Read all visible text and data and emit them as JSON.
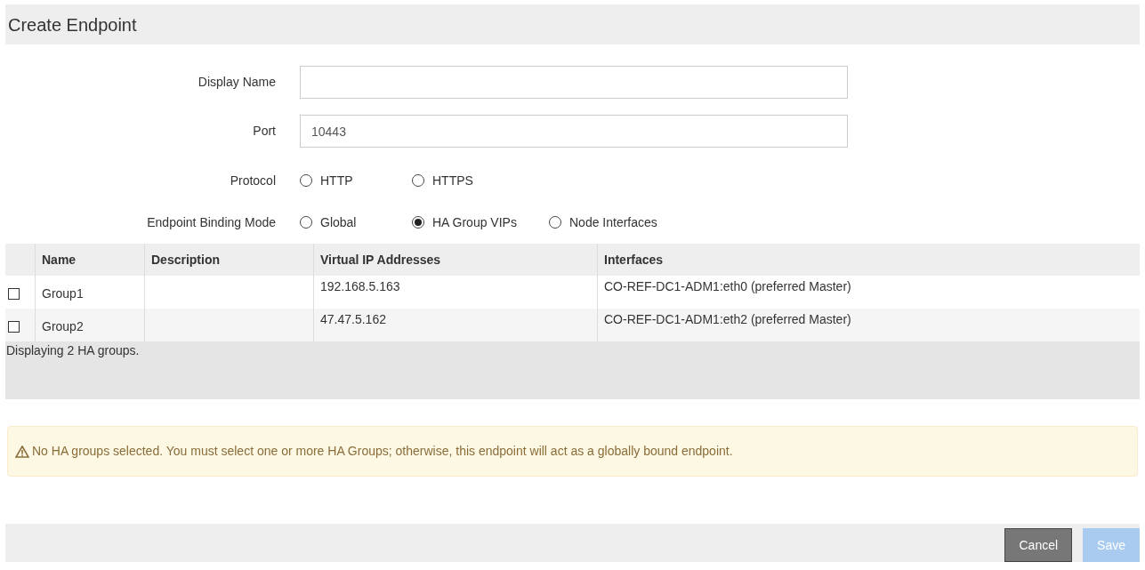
{
  "title": "Create Endpoint",
  "fields": [
    {
      "label": "Display Name"
    },
    {
      "label": "Port",
      "value": "10443"
    }
  ],
  "radio_groups": [
    {
      "label": "Protocol",
      "options": [
        {
          "label": "HTTP",
          "selected": false
        },
        {
          "label": "HTTPS",
          "selected": false
        }
      ]
    },
    {
      "label": "Endpoint Binding Mode",
      "options": [
        {
          "label": "Global",
          "selected": false
        },
        {
          "label": "HA Group VIPs",
          "selected": true
        },
        {
          "label": "Node Interfaces",
          "selected": false
        }
      ]
    }
  ],
  "table": {
    "columns": [
      "Name",
      "Description",
      "Virtual IP Addresses",
      "Interfaces"
    ],
    "rows": [
      {
        "checked": false,
        "cells": [
          "Group1",
          null,
          "192.168.5.163",
          "CO-REF-DC1-ADM1:eth0 (preferred Master)"
        ]
      },
      {
        "checked": false,
        "cells": [
          "Group2",
          null,
          "47.47.5.162",
          "CO-REF-DC1-ADM1:eth2 (preferred Master)"
        ]
      }
    ],
    "footer": "Displaying 2 HA groups."
  },
  "warning": "No HA groups selected. You must select one or more HA Groups; otherwise, this endpoint will act as a globally bound endpoint.",
  "buttons": [
    {
      "label": "Cancel",
      "disabled": false
    },
    {
      "label": "Save",
      "disabled": true
    }
  ]
}
